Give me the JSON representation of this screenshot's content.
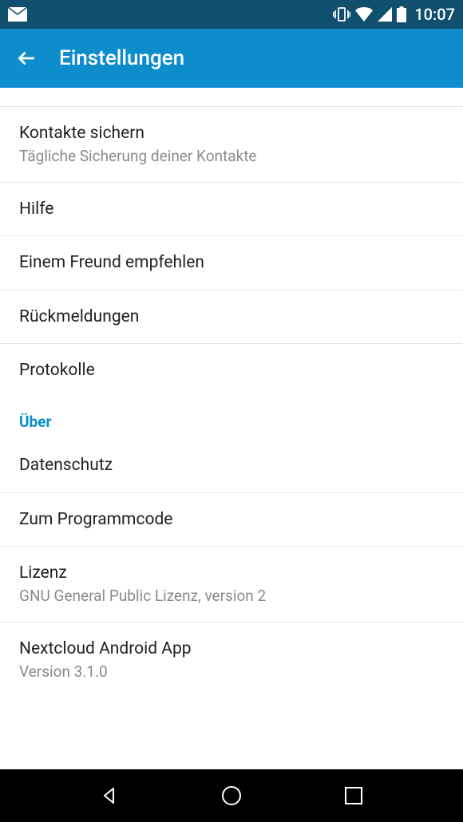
{
  "status": {
    "time": "10:07"
  },
  "appbar": {
    "title": "Einstellungen"
  },
  "items": [
    {
      "title": "Kontakte sichern",
      "subtitle": "Tägliche Sicherung deiner Kontakte"
    },
    {
      "title": "Hilfe"
    },
    {
      "title": "Einem Freund empfehlen"
    },
    {
      "title": "Rückmeldungen"
    },
    {
      "title": "Protokolle"
    }
  ],
  "section_about": "Über",
  "about_items": [
    {
      "title": "Datenschutz"
    },
    {
      "title": "Zum Programmcode"
    },
    {
      "title": "Lizenz",
      "subtitle": "GNU General Public Lizenz, version 2"
    },
    {
      "title": "Nextcloud Android App",
      "subtitle": "Version 3.1.0"
    }
  ]
}
